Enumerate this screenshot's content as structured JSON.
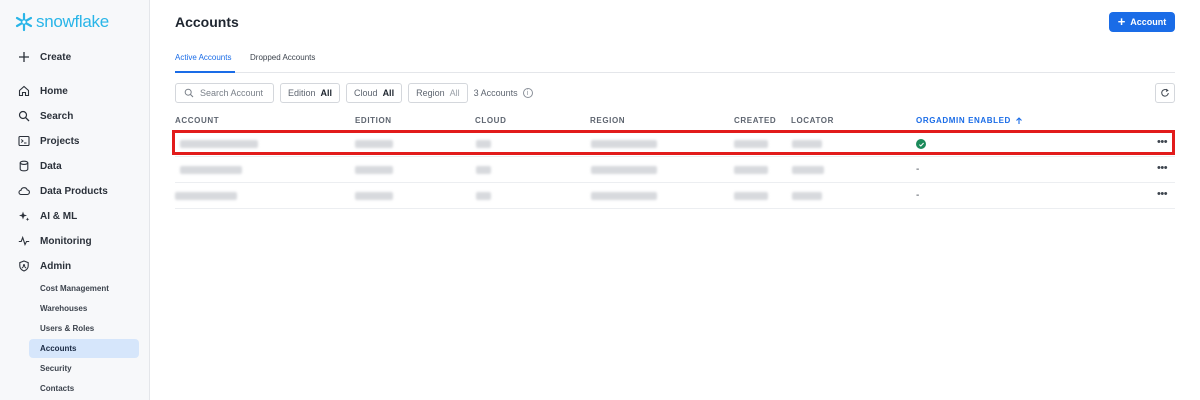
{
  "brand": {
    "name": "snowflake",
    "color": "#29b5e8"
  },
  "sidebar": {
    "create_label": "Create",
    "items": [
      {
        "label": "Home",
        "icon": "home-icon"
      },
      {
        "label": "Search",
        "icon": "search-icon"
      },
      {
        "label": "Projects",
        "icon": "terminal-icon"
      },
      {
        "label": "Data",
        "icon": "database-icon"
      },
      {
        "label": "Data Products",
        "icon": "cloud-icon"
      },
      {
        "label": "AI & ML",
        "icon": "sparkle-icon"
      },
      {
        "label": "Monitoring",
        "icon": "activity-icon"
      },
      {
        "label": "Admin",
        "icon": "shield-icon"
      }
    ],
    "admin_sub": [
      {
        "label": "Cost Management"
      },
      {
        "label": "Warehouses"
      },
      {
        "label": "Users & Roles"
      },
      {
        "label": "Accounts",
        "active": true
      },
      {
        "label": "Security"
      },
      {
        "label": "Contacts"
      }
    ]
  },
  "header": {
    "title": "Accounts",
    "add_label": "Account"
  },
  "tabs": [
    {
      "label": "Active Accounts",
      "active": true
    },
    {
      "label": "Dropped Accounts"
    }
  ],
  "filters": {
    "search_placeholder": "Search Account",
    "edition": {
      "label": "Edition",
      "value": "All"
    },
    "cloud": {
      "label": "Cloud",
      "value": "All"
    },
    "region": {
      "label": "Region",
      "value": "All"
    },
    "count_text": "3 Accounts"
  },
  "table": {
    "columns": [
      "ACCOUNT",
      "EDITION",
      "CLOUD",
      "REGION",
      "CREATED",
      "LOCATOR",
      "ORGADMIN ENABLED"
    ],
    "sorted_column": "ORGADMIN ENABLED",
    "rows": [
      {
        "orgadmin": "enabled"
      },
      {
        "orgadmin": "-"
      },
      {
        "orgadmin": "-"
      }
    ]
  },
  "colors": {
    "accent": "#1a6ce7",
    "highlight": "#e21b1b",
    "success": "#1b8a5a"
  }
}
